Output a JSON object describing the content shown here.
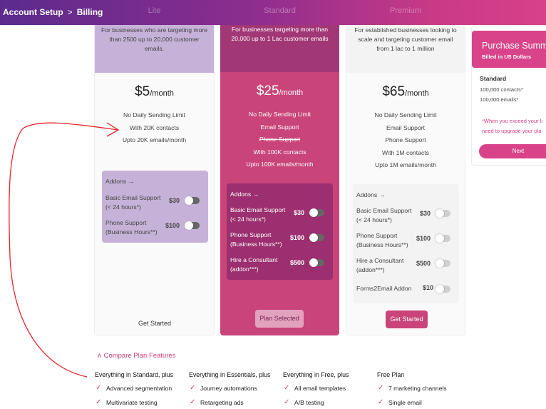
{
  "breadcrumb": {
    "root": "Account Setup",
    "separator": ">",
    "current": "Billing"
  },
  "plans": [
    {
      "name": "Lite",
      "description": "For businesses who are targeting more than 2500 up to 20,000 customer emails.",
      "price": "$5",
      "period": "/month",
      "features": [
        "No Daily Sending Limit",
        "With 20K contacts",
        "Upto 20K emails/month"
      ],
      "addons_title": "Addons →",
      "addons": [
        {
          "label": "Basic Email Support (< 24 hours*)",
          "price": "$30"
        },
        {
          "label": "Phone Support (Business Hours**)",
          "price": "$100"
        }
      ],
      "cta": "Get Started"
    },
    {
      "name": "Standard",
      "description": "For businesses targeting more than 20,000 up to 1 Lac customer emails",
      "price": "$25",
      "period": "/month",
      "features": [
        "No Daily Sending Limit",
        "Email Support",
        "Phone Support",
        "With 100K contacts",
        "Upto 100K emails/month"
      ],
      "addons_title": "Addons →",
      "addons": [
        {
          "label": "Basic Email Support (< 24 hours*)",
          "price": "$30"
        },
        {
          "label": "Phone Support (Business Hours**)",
          "price": "$100"
        },
        {
          "label": "Hire a Consultant (addon***)",
          "price": "$500"
        }
      ],
      "cta": "Plan Selected"
    },
    {
      "name": "Premium",
      "description": "For established businesses looking to scale and targeting customer email from 1 lac to 1 million",
      "price": "$65",
      "period": "/month",
      "features": [
        "No Daily Sending Limit",
        "Email Support",
        "Phone Support",
        "With 1M contacts",
        "Upto 1M emails/month"
      ],
      "addons_title": "Addons →",
      "addons": [
        {
          "label": "Basic Email Support (< 24 hours*)",
          "price": "$30"
        },
        {
          "label": "Phone Support (Business Hours**)",
          "price": "$100"
        },
        {
          "label": "Hire a Consultant (addon***)",
          "price": "$500"
        },
        {
          "label": "Forms2Email Addon",
          "price": "$10"
        }
      ],
      "cta": "Get Started"
    }
  ],
  "summary": {
    "title": "Purchase Summ",
    "billed_prefix": "Billed in ",
    "billed_currency": "US Dollars",
    "plan": "Standard",
    "contacts": "100,000 contacts*",
    "emails": "100,000 emails*",
    "note_line1": "*When you exceed your li",
    "note_line2": "need to upgrade your pla",
    "next": "Next"
  },
  "compare": {
    "toggle": "∧ Compare Plan Features",
    "columns": [
      {
        "header": "Everything in Standard, plus",
        "items": [
          "Advanced segmentation",
          "Multivariate testing"
        ]
      },
      {
        "header": "Everything in Essentials, plus",
        "items": [
          "Journey automations",
          "Retargeting ads"
        ]
      },
      {
        "header": "Everything in Free, plus",
        "items": [
          "All email templates",
          "A/B testing"
        ]
      },
      {
        "header": "Free Plan",
        "items": [
          "7 marketing channels",
          "Single email"
        ]
      }
    ]
  },
  "colors": {
    "accent": "#c94478",
    "header_start": "#5b2b8c",
    "header_end": "#d8408a",
    "annotation": "#e3262b"
  }
}
